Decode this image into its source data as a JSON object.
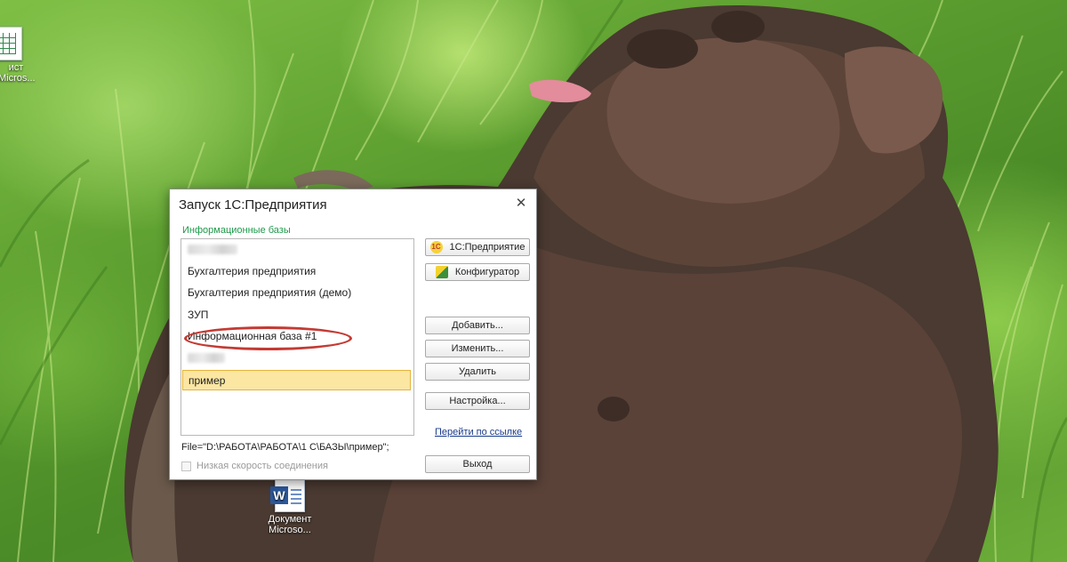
{
  "desktop": {
    "icons": [
      {
        "label_line1": "ист",
        "label_line2": "Micros..."
      },
      {
        "label_line1": "Документ",
        "label_line2": "Microso..."
      }
    ]
  },
  "dialog": {
    "title": "Запуск 1С:Предприятия",
    "close_glyph": "✕",
    "group_label": "Информационные базы",
    "bases": [
      {
        "name": ""
      },
      {
        "name": "Бухгалтерия предприятия"
      },
      {
        "name": "Бухгалтерия предприятия (демо)"
      },
      {
        "name": "ЗУП"
      },
      {
        "name": "Информационная база #1"
      },
      {
        "name": ""
      },
      {
        "name": "пример",
        "selected": true
      }
    ],
    "buttons": {
      "enterprise": "1С:Предприятие",
      "configurator": "Конфигуратор",
      "add": "Добавить...",
      "edit": "Изменить...",
      "delete": "Удалить",
      "settings": "Настройка...",
      "exit": "Выход"
    },
    "link": "Перейти по ссылке",
    "file_path": "File=\"D:\\РАБОТА\\РАБОТА\\1 С\\БАЗЫ\\пример\";",
    "slow_connection_label": "Низкая скорость соединения",
    "slow_connection_checked": false,
    "icons": {
      "enterprise": "1c-logo-icon",
      "configurator": "configurator-icon"
    }
  },
  "colors": {
    "group_label": "#1e9a4b",
    "selection": "#fbe6a2",
    "annotation": "#c43a33",
    "link": "#1a3b8a"
  }
}
